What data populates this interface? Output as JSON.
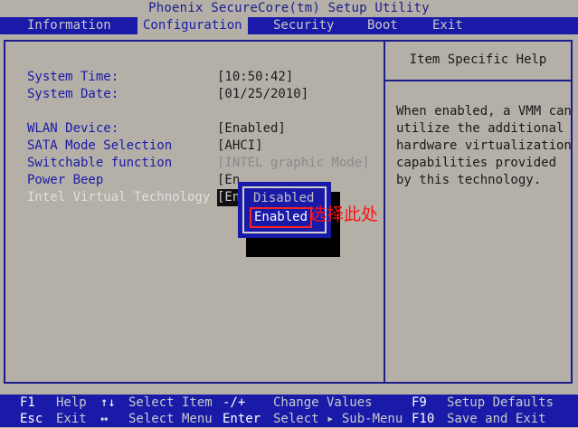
{
  "title": "Phoenix SecureCore(tm) Setup Utility",
  "menu": {
    "items": [
      "Information",
      "Configuration",
      "Security",
      "Boot",
      "Exit"
    ],
    "active": "Configuration"
  },
  "settings": {
    "system_time": {
      "label": "System Time:",
      "value": "[10:50:42]"
    },
    "system_date": {
      "label": "System Date:",
      "value": "[01/25/2010]"
    },
    "wlan_device": {
      "label": "WLAN Device:",
      "value": "[Enabled]"
    },
    "sata_mode": {
      "label": "SATA Mode Selection",
      "value": "[AHCI]"
    },
    "switchable": {
      "label": "Switchable function",
      "value": "[INTEL graphic Mode]"
    },
    "power_beep": {
      "label": "Power Beep",
      "value": "[En"
    },
    "intel_vt": {
      "label": "Intel Virtual Technology",
      "value": "[En"
    }
  },
  "help": {
    "title": "Item Specific Help",
    "lines": [
      "When enabled, a VMM can",
      "utilize the additional",
      "hardware virtualization",
      "capabilities provided",
      "by this technology."
    ]
  },
  "popup": {
    "options": [
      "Disabled",
      "Enabled"
    ],
    "selected": "Enabled"
  },
  "annotation": "选择此处",
  "footer": {
    "row1": [
      {
        "key": "F1",
        "desc": "Help"
      },
      {
        "key": "↑↓",
        "desc": "Select Item"
      },
      {
        "key": "-/+",
        "desc": "Change Values"
      },
      {
        "key": "F9",
        "desc": "Setup Defaults"
      }
    ],
    "row2": [
      {
        "key": "Esc",
        "desc": "Exit"
      },
      {
        "key": "↔",
        "desc": "Select Menu"
      },
      {
        "key": "Enter",
        "desc": "Select ▸ Sub-Menu"
      },
      {
        "key": "F10",
        "desc": "Save and Exit"
      }
    ]
  },
  "colors": {
    "background": "#b4b0a8",
    "bar_blue": "#1a1aa8",
    "label_blue": "#1a1aa8",
    "annotation_red": "#ff1010"
  }
}
